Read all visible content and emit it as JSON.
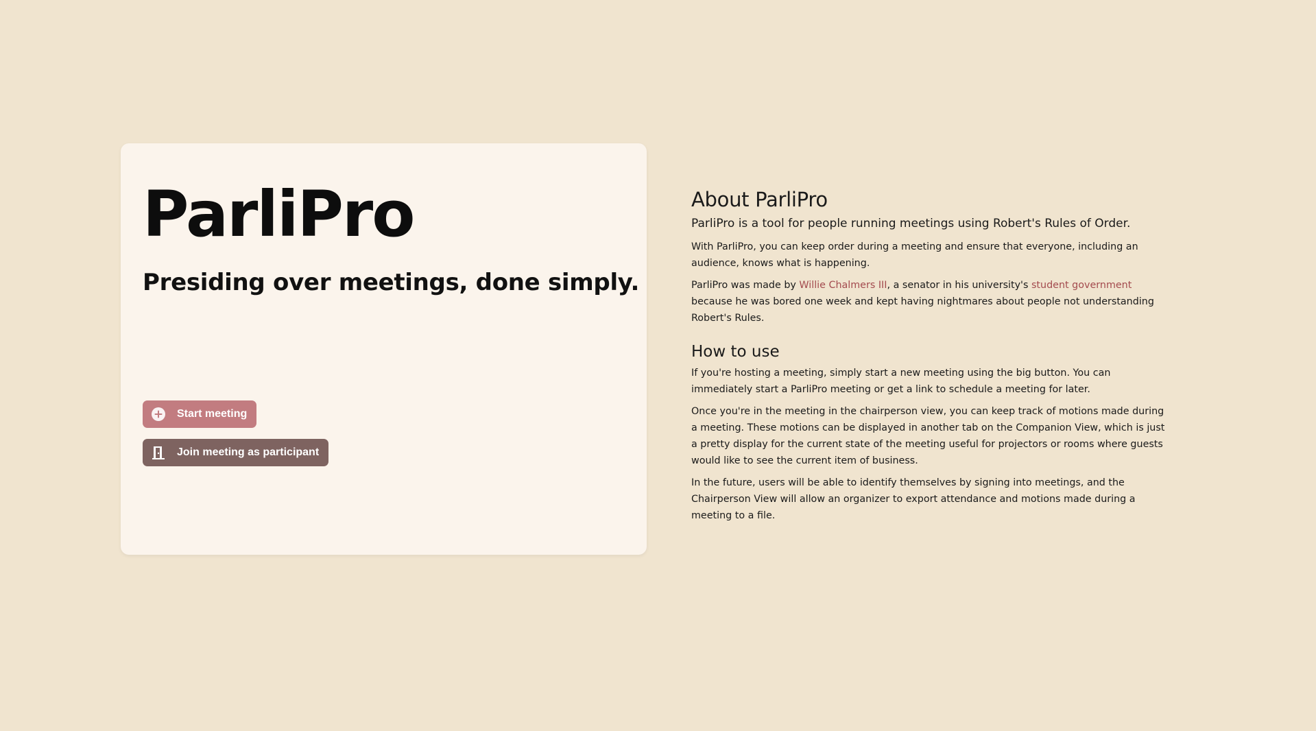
{
  "hero": {
    "title": "ParliPro",
    "tagline": "Presiding over meetings, done simply.",
    "start_button": "Start meeting",
    "join_button": "Join meeting as participant"
  },
  "icons": {
    "start": "plus-circle-icon",
    "join": "door-icon"
  },
  "about": {
    "heading": "About ParliPro",
    "lead": "ParliPro is a tool for people running meetings using Robert's Rules of Order.",
    "p1": "With ParliPro, you can keep order during a meeting and ensure that everyone, including an audience, knows what is happening.",
    "p2_before": "ParliPro was made by ",
    "p2_link1": "Willie Chalmers III",
    "p2_middle": ", a senator in his university's ",
    "p2_link2": "student government",
    "p2_after": " because he was bored one week and kept having nightmares about people not understanding Robert's Rules."
  },
  "howto": {
    "heading": "How to use",
    "p1": "If you're hosting a meeting, simply start a new meeting using the big button. You can immediately start a ParliPro meeting or get a link to schedule a meeting for later.",
    "p2": "Once you're in the meeting in the chairperson view, you can keep track of motions made during a meeting. These motions can be displayed in another tab on the Companion View, which is just a pretty display for the current state of the meeting useful for projectors or rooms where guests would like to see the current item of business.",
    "p3": "In the future, users will be able to identify themselves by signing into meetings, and the Chairperson View will allow an organizer to export attendance and motions made during a meeting to a file."
  },
  "colors": {
    "background": "#F0E4CF",
    "card": "#FBF4EC",
    "start_button": "#C27C80",
    "join_button": "#7E6360",
    "link": "#A34A4E"
  }
}
